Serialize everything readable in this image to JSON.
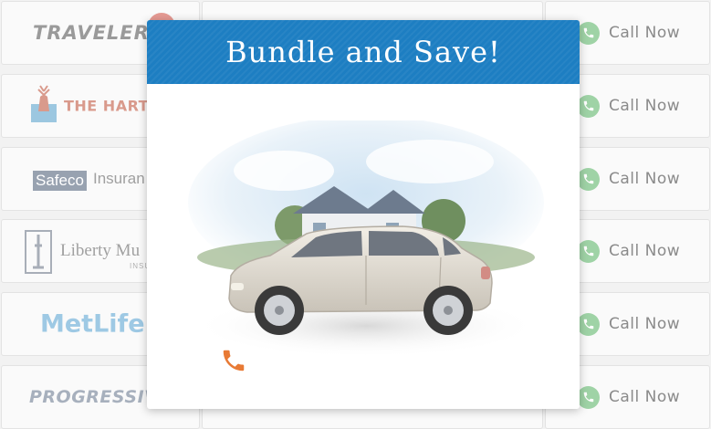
{
  "modal": {
    "title": "Bundle and Save!",
    "header_color": "#1d7ec2",
    "phone_icon": "phone-icon",
    "phone_color": "#e87a35"
  },
  "insurers": [
    {
      "name": "TRAVELERS",
      "call_label": "Call Now"
    },
    {
      "name": "THE HARTFO",
      "call_label": "Call Now"
    },
    {
      "name_box": "Safeco",
      "name": "Insuran",
      "call_label": "Call Now"
    },
    {
      "name": "Liberty Mu",
      "sub": "INSU",
      "call_label": "Call Now"
    },
    {
      "name": "MetLife",
      "call_label": "Call Now"
    },
    {
      "name": "PROGRESSIV",
      "call_label": "Call Now"
    }
  ],
  "call_icon": "phone-icon",
  "call_color": "#9fd3a6"
}
